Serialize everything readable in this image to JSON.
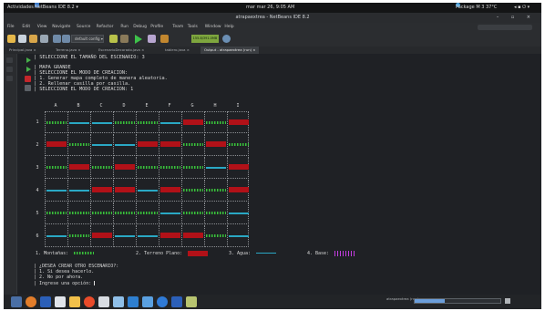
{
  "topbar": {
    "activities": "Actividades",
    "app": "NetBeans IDE 8.2 ▾",
    "clock": "mar mar 26, 9:05 AM",
    "weather": "Package M 3 37°C",
    "indicators": "◂ ▪ ⏻ ▾"
  },
  "window": {
    "title": "atrapaextrea - NetBeans IDE 8.2",
    "controls": "– ▫ ×"
  },
  "menu": {
    "items": [
      "File",
      "Edit",
      "View",
      "Navigate",
      "Source",
      "Refactor",
      "Run",
      "Debug",
      "Profile",
      "Team",
      "Tools",
      "Window",
      "Help"
    ]
  },
  "toolbar": {
    "config": "default config ▾",
    "memory": "155.8/391.0MB"
  },
  "tabs": [
    {
      "label": "Principal.java ×",
      "active": false
    },
    {
      "label": "Terreno.java ×",
      "active": false
    },
    {
      "label": "EscenarioDecorado.java ×",
      "active": false
    },
    {
      "label": "tablero.java ×",
      "active": false
    },
    {
      "label": "Output - atrapaextrea (run) ×",
      "active": true
    }
  ],
  "console": {
    "line_a": "| SELECCIONE EL TAMAÑO DEL ESCENARIO: 3",
    "line_b": "| MAPA GRANDE",
    "line_c": "| SELECCIONE EL MODO DE CREACION:",
    "line_d": "| 1. Generar mapa completo de manera aleatoria.",
    "line_e": "| 2. Rellenar casilla por casilla.",
    "line_f": "| SELECCIONE EL MODO DE CREACION: 1"
  },
  "board": {
    "columns": [
      "A",
      "B",
      "C",
      "D",
      "E",
      "F",
      "G",
      "H",
      "I"
    ],
    "rows": [
      {
        "label": "1",
        "cells": [
          "m",
          "a",
          "a",
          "m",
          "m",
          "a",
          "p",
          "m",
          "p"
        ]
      },
      {
        "label": "2",
        "cells": [
          "p",
          "m",
          "a",
          "a",
          "p",
          "p",
          "m",
          "p",
          "m"
        ]
      },
      {
        "label": "3",
        "cells": [
          "m",
          "p",
          "m",
          "p",
          "m",
          "m",
          "m",
          "a",
          "p"
        ]
      },
      {
        "label": "4",
        "cells": [
          "a",
          "a",
          "p",
          "p",
          "a",
          "p",
          "m",
          "m",
          "p"
        ]
      },
      {
        "label": "5",
        "cells": [
          "m",
          "m",
          "m",
          "m",
          "m",
          "a",
          "m",
          "m",
          "a"
        ]
      },
      {
        "label": "6",
        "cells": [
          "a",
          "m",
          "p",
          "a",
          "a",
          "p",
          "p",
          "m",
          "a"
        ]
      }
    ]
  },
  "legend": {
    "montanas": "1. Montañas:",
    "terreno": "2. Terreno Plano:",
    "agua": "3. Agua:",
    "base": "4. Base:"
  },
  "prompt": {
    "q": "| ¿DESEA CREAR OTRO ESCENARIO?:",
    "opt1": "| 1. Si desea hacerlo.",
    "opt2": "| 2. No por ahora.",
    "input": "| Ingrese una opción: "
  },
  "status": {
    "label": "atrapaextrea (run)",
    "progress": 0.35
  },
  "colors": {
    "mountain": "#38c23a",
    "plain": "#b11118",
    "water": "#2aa8c4",
    "base": "#c33de0"
  }
}
